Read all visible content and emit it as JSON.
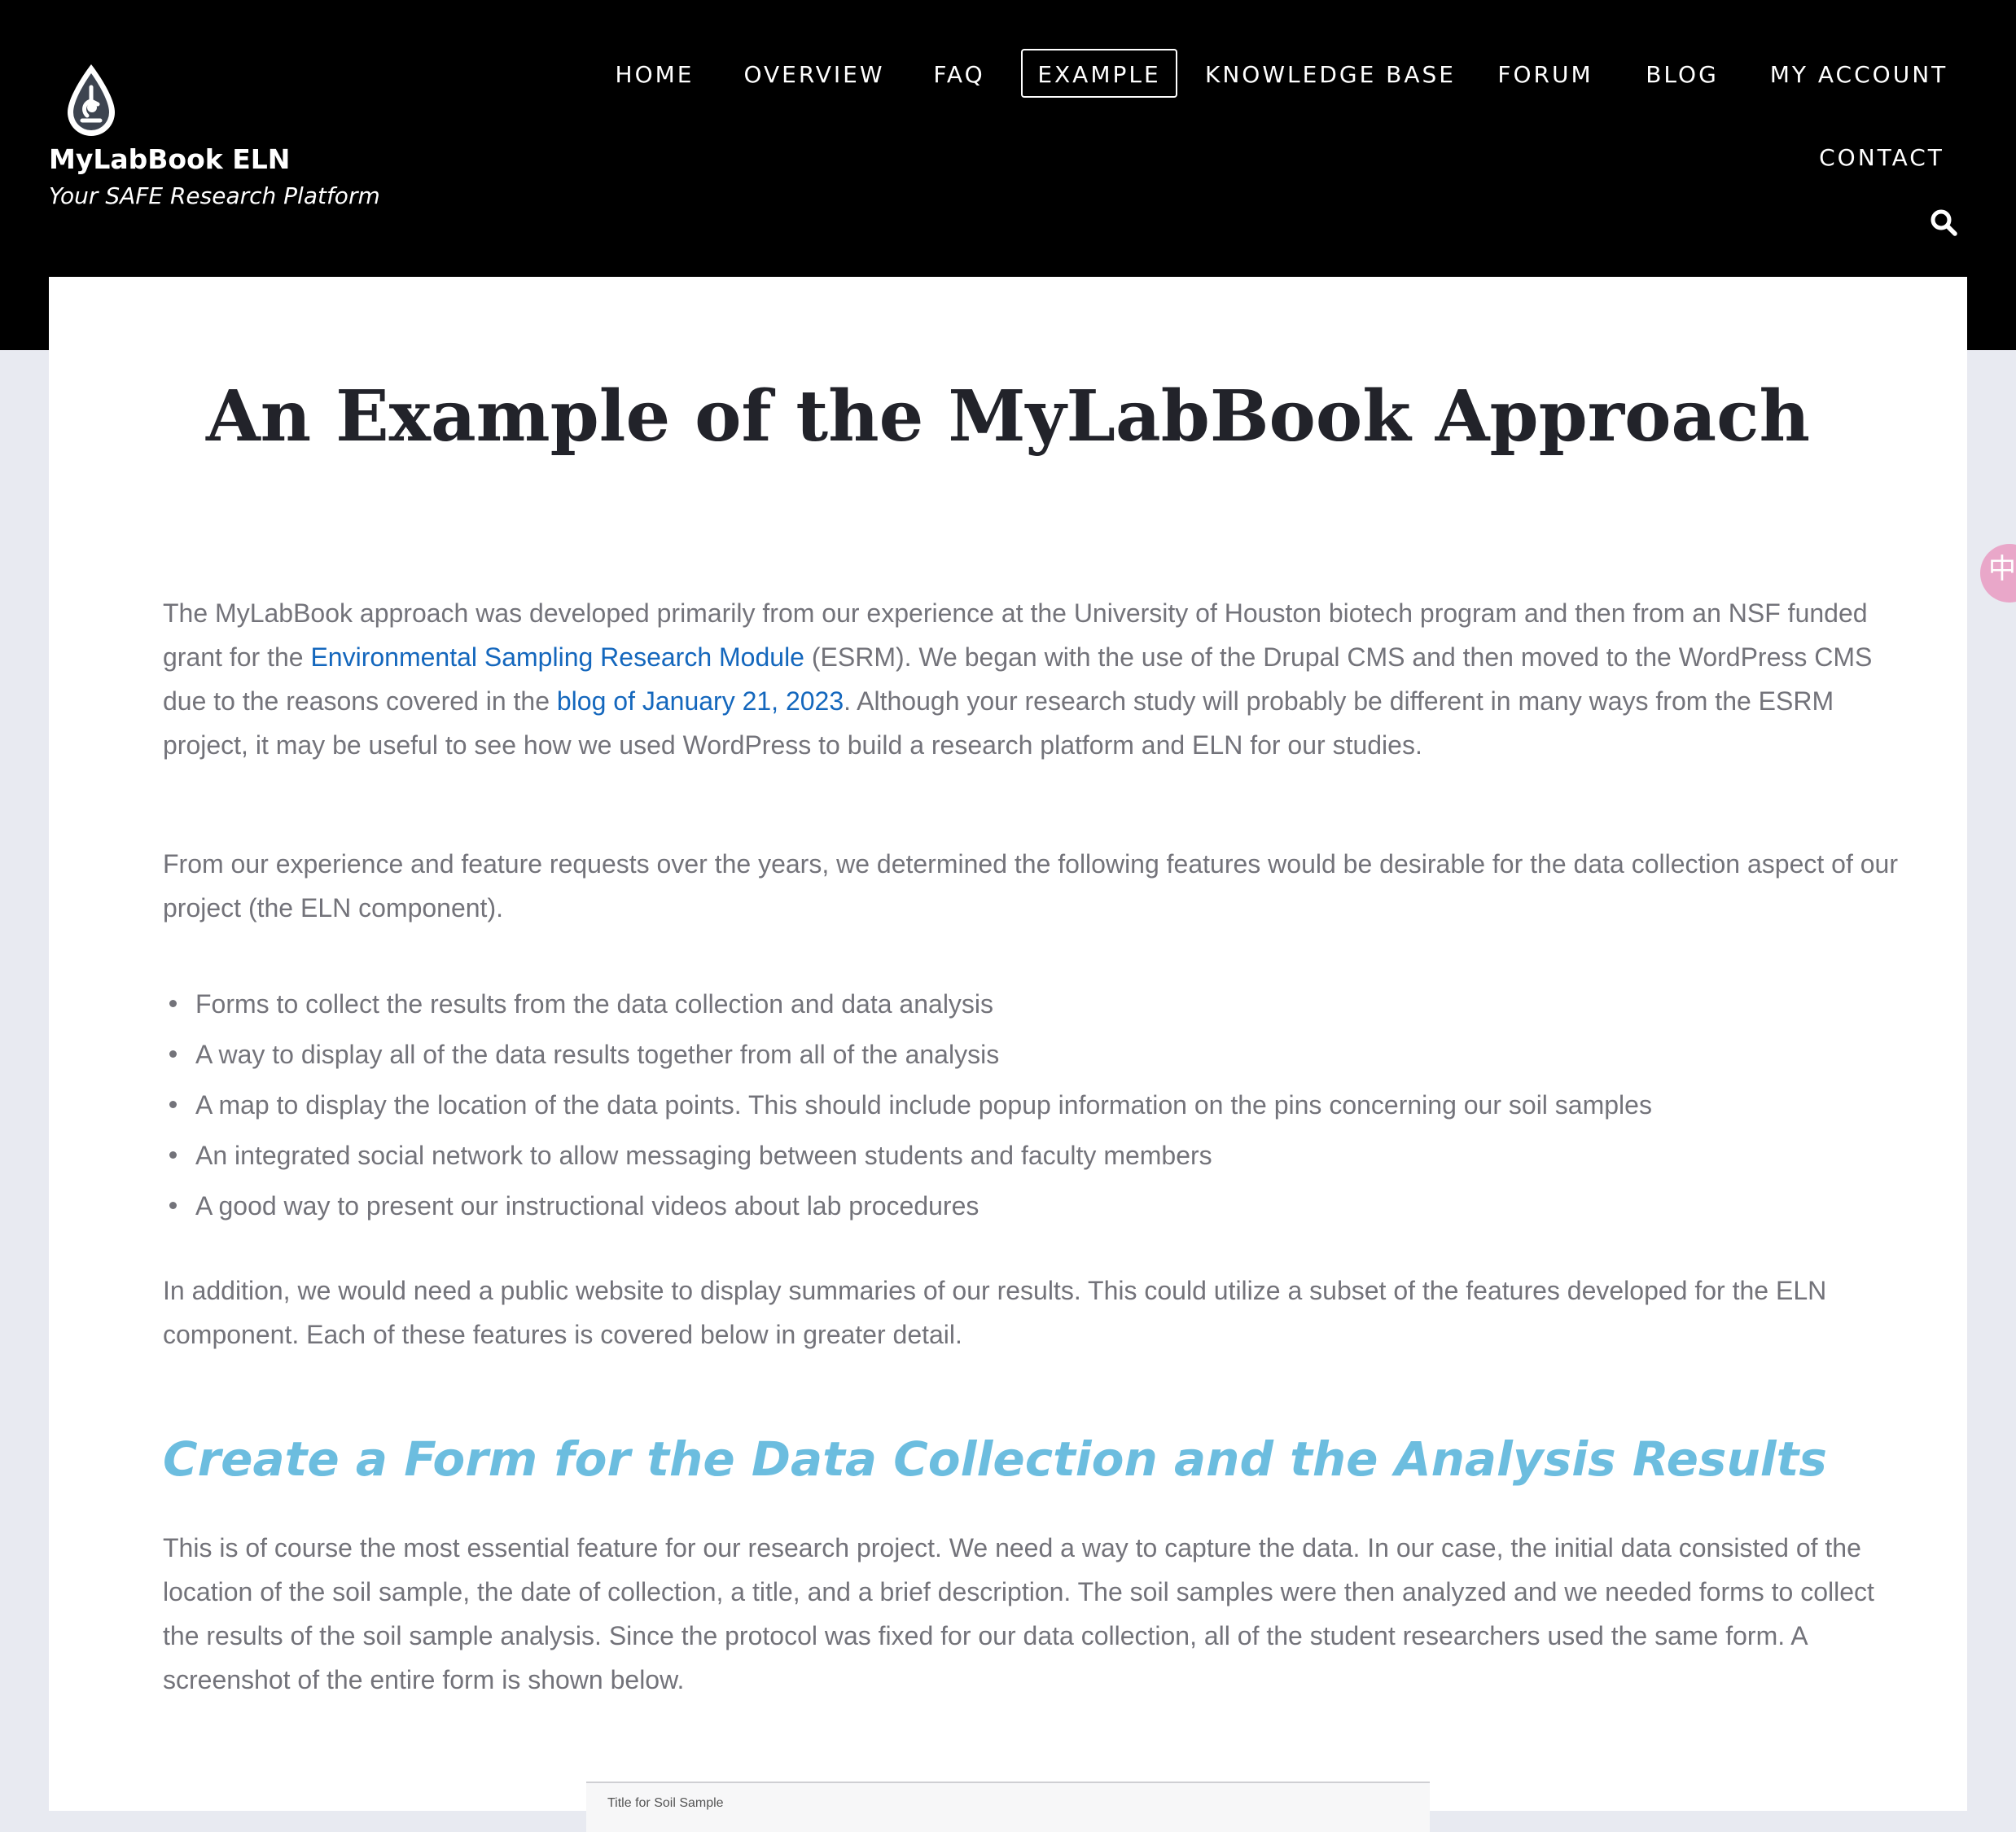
{
  "site": {
    "name": "MyLabBook ELN",
    "tagline": "Your SAFE Research Platform"
  },
  "nav": {
    "items": [
      {
        "label": "HOME"
      },
      {
        "label": "OVERVIEW"
      },
      {
        "label": "FAQ"
      },
      {
        "label": "EXAMPLE",
        "active": true
      },
      {
        "label": "KNOWLEDGE BASE"
      },
      {
        "label": "FORUM"
      },
      {
        "label": "BLOG"
      },
      {
        "label": "MY ACCOUNT"
      },
      {
        "label": "CONTACT"
      }
    ],
    "search_icon": "search-icon"
  },
  "page": {
    "title": "An Example of the MyLabBook Approach",
    "intro": {
      "part1": "The MyLabBook approach was developed primarily from our experience at the University of Houston biotech program and then from an NSF funded grant for the ",
      "link1": "Environmental Sampling Research Module",
      "part2": " (ESRM). We began with the use of the Drupal CMS and then moved to the WordPress CMS due to the reasons covered in the ",
      "link2": "blog of January 21, 2023",
      "part3": ". Although your research study will probably be different in many ways from the ESRM project, it may be useful to see how we used WordPress to build a research platform and ELN for our studies."
    },
    "features_intro": "From our experience and feature requests over the years, we determined the following features would be desirable for the data collection aspect of our project (the ELN component).",
    "features": [
      "Forms to collect the results from the data collection and data analysis",
      "A way to display all of the data results together from all of the analysis",
      "A map to display the location of the data points. This should include popup information on the pins concerning our soil samples",
      "An integrated social network to allow messaging between students and faculty members",
      "A good way to present our instructional videos about lab procedures"
    ],
    "addition": "In addition, we would need a public website to display summaries of our results. This could utilize a subset of the features developed for the ELN component. Each of these features is covered below in greater detail.",
    "section_heading": "Create a Form for the Data Collection and the Analysis Results",
    "section_body": "This is of course the most essential feature for our research project. We need a way to capture the data. In our case, the initial data consisted of the location of the soil sample, the date of collection, a title, and a brief description. The soil samples were then analyzed and we needed forms to collect the results of the soil sample analysis. Since the protocol was fixed for our data collection, all of the student researchers used the same form. A screenshot of the entire form is shown below.",
    "form_preview_label": "Title for Soil Sample"
  },
  "widget": {
    "glyph": "中"
  },
  "colors": {
    "header_bg": "#000000",
    "link": "#1467bd",
    "heading_accent": "#6cbddf",
    "body_text": "#73737a",
    "page_bg": "#e8eaf1"
  }
}
